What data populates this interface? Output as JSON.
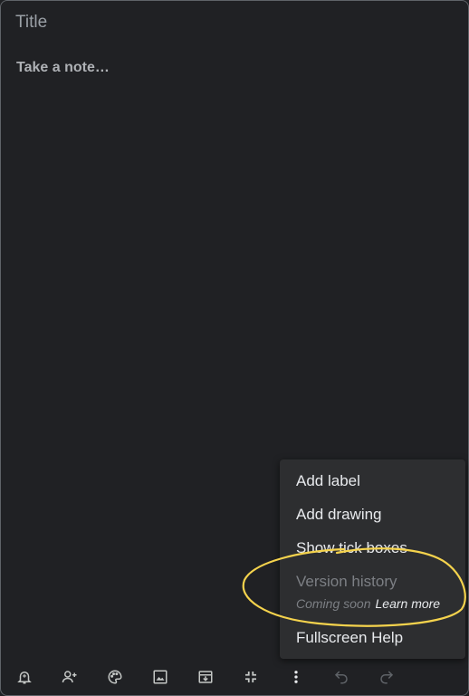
{
  "note": {
    "title_placeholder": "Title",
    "body_placeholder": "Take a note…"
  },
  "menu": {
    "items": [
      {
        "label": "Add label"
      },
      {
        "label": "Add drawing"
      },
      {
        "label": "Show tick boxes"
      },
      {
        "label": "Version history"
      },
      {
        "label": "Fullscreen Help"
      }
    ],
    "version_status": "Coming soon",
    "learn_more": "Learn more"
  },
  "toolbar": {
    "icons": [
      "remind-me-icon",
      "collaborator-icon",
      "palette-icon",
      "image-icon",
      "archive-icon",
      "exit-fullscreen-icon",
      "more-icon",
      "undo-icon",
      "redo-icon"
    ]
  },
  "colors": {
    "background": "#202124",
    "menu_background": "#2d2e30",
    "text": "#e8eaed",
    "muted": "#9aa0a6",
    "highlight": "#f5d34d"
  }
}
